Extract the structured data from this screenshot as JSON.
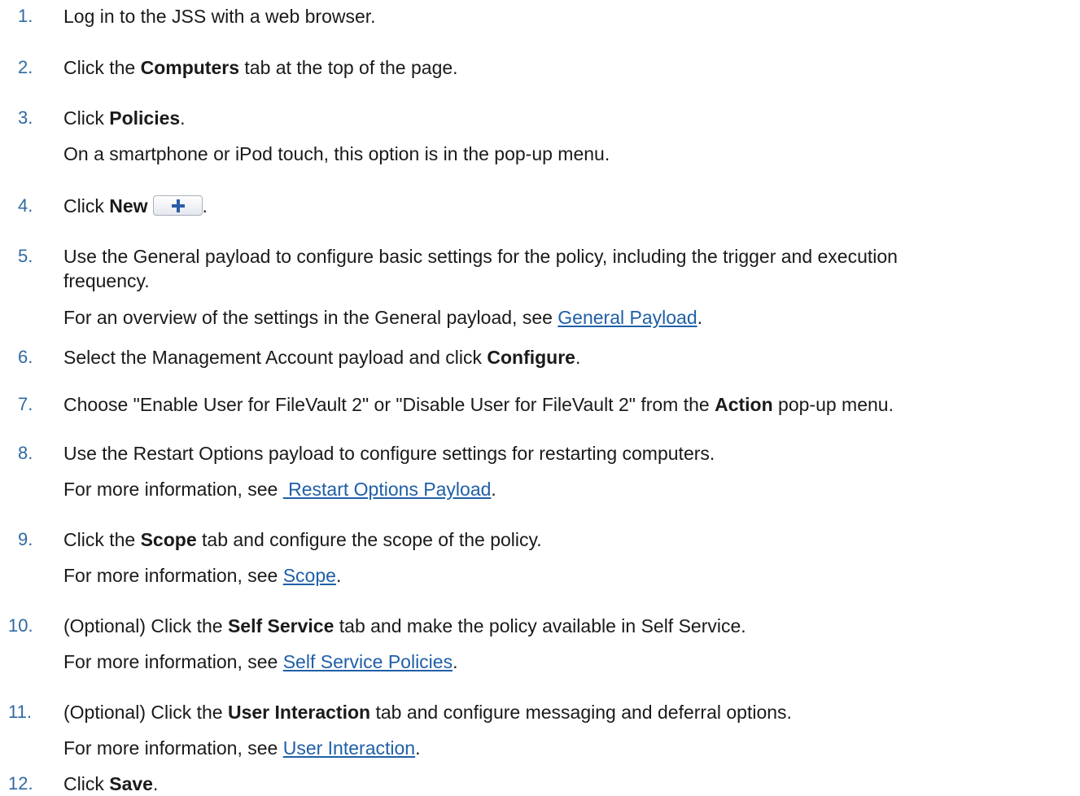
{
  "steps": [
    {
      "n": "1.",
      "parts": [
        {
          "t": "Log in to the JSS with a web browser."
        }
      ]
    },
    {
      "n": "2.",
      "parts": [
        {
          "t": "Click the "
        },
        {
          "b": "Computers"
        },
        {
          "t": " tab at the top of the page."
        }
      ]
    },
    {
      "n": "3.",
      "parts": [
        {
          "t": "Click "
        },
        {
          "b": "Policies"
        },
        {
          "t": "."
        }
      ],
      "note": [
        {
          "t": "On a smartphone or iPod touch, this option is in the pop-up menu."
        }
      ]
    },
    {
      "n": "4.",
      "parts": [
        {
          "t": "Click "
        },
        {
          "b": "New"
        },
        {
          "icon": "plus-icon"
        },
        {
          "t": "."
        }
      ]
    },
    {
      "n": "5.",
      "parts": [
        {
          "t": "Use the General payload to configure basic settings for the policy, including the trigger and execution"
        }
      ],
      "cont": [
        {
          "t": "frequency."
        }
      ],
      "note": [
        {
          "t": "For an overview of the settings in the General payload, see "
        },
        {
          "a": "General Payload"
        },
        {
          "t": "."
        }
      ]
    },
    {
      "n": "6.",
      "parts": [
        {
          "t": "Select the Management Account payload and click "
        },
        {
          "b": "Configure"
        },
        {
          "t": "."
        }
      ]
    },
    {
      "n": "7.",
      "parts": [
        {
          "t": "Choose \"Enable User for FileVault 2\" or \"Disable User for FileVault 2\" from the "
        },
        {
          "b": "Action"
        },
        {
          "t": " pop-up menu."
        }
      ]
    },
    {
      "n": "8.",
      "parts": [
        {
          "t": "Use the Restart Options payload to configure settings for restarting computers."
        }
      ],
      "note": [
        {
          "t": "For more information, see "
        },
        {
          "a": " Restart Options Payload"
        },
        {
          "t": "."
        }
      ]
    },
    {
      "n": "9.",
      "parts": [
        {
          "t": "Click the "
        },
        {
          "b": "Scope"
        },
        {
          "t": " tab and configure the scope of the policy."
        }
      ],
      "note": [
        {
          "t": "For more information, see "
        },
        {
          "a": "Scope"
        },
        {
          "t": "."
        }
      ]
    },
    {
      "n": "10.",
      "parts": [
        {
          "t": "(Optional) Click the "
        },
        {
          "b": "Self Service"
        },
        {
          "t": " tab and make the policy available in Self Service."
        }
      ],
      "note": [
        {
          "t": "For more information, see "
        },
        {
          "a": "Self Service Policies"
        },
        {
          "t": "."
        }
      ]
    },
    {
      "n": "11.",
      "parts": [
        {
          "t": "(Optional) Click the "
        },
        {
          "b": "User Interaction"
        },
        {
          "t": " tab and configure messaging and deferral options."
        }
      ],
      "note": [
        {
          "t": "For more information, see "
        },
        {
          "a": "User Interaction"
        },
        {
          "t": "."
        }
      ]
    },
    {
      "n": "12.",
      "parts": [
        {
          "t": "Click "
        },
        {
          "b": "Save"
        },
        {
          "t": "."
        }
      ]
    }
  ],
  "colors": {
    "number": "#2f6aa3",
    "link": "#1f5fa8",
    "text": "#1a1a1a"
  }
}
